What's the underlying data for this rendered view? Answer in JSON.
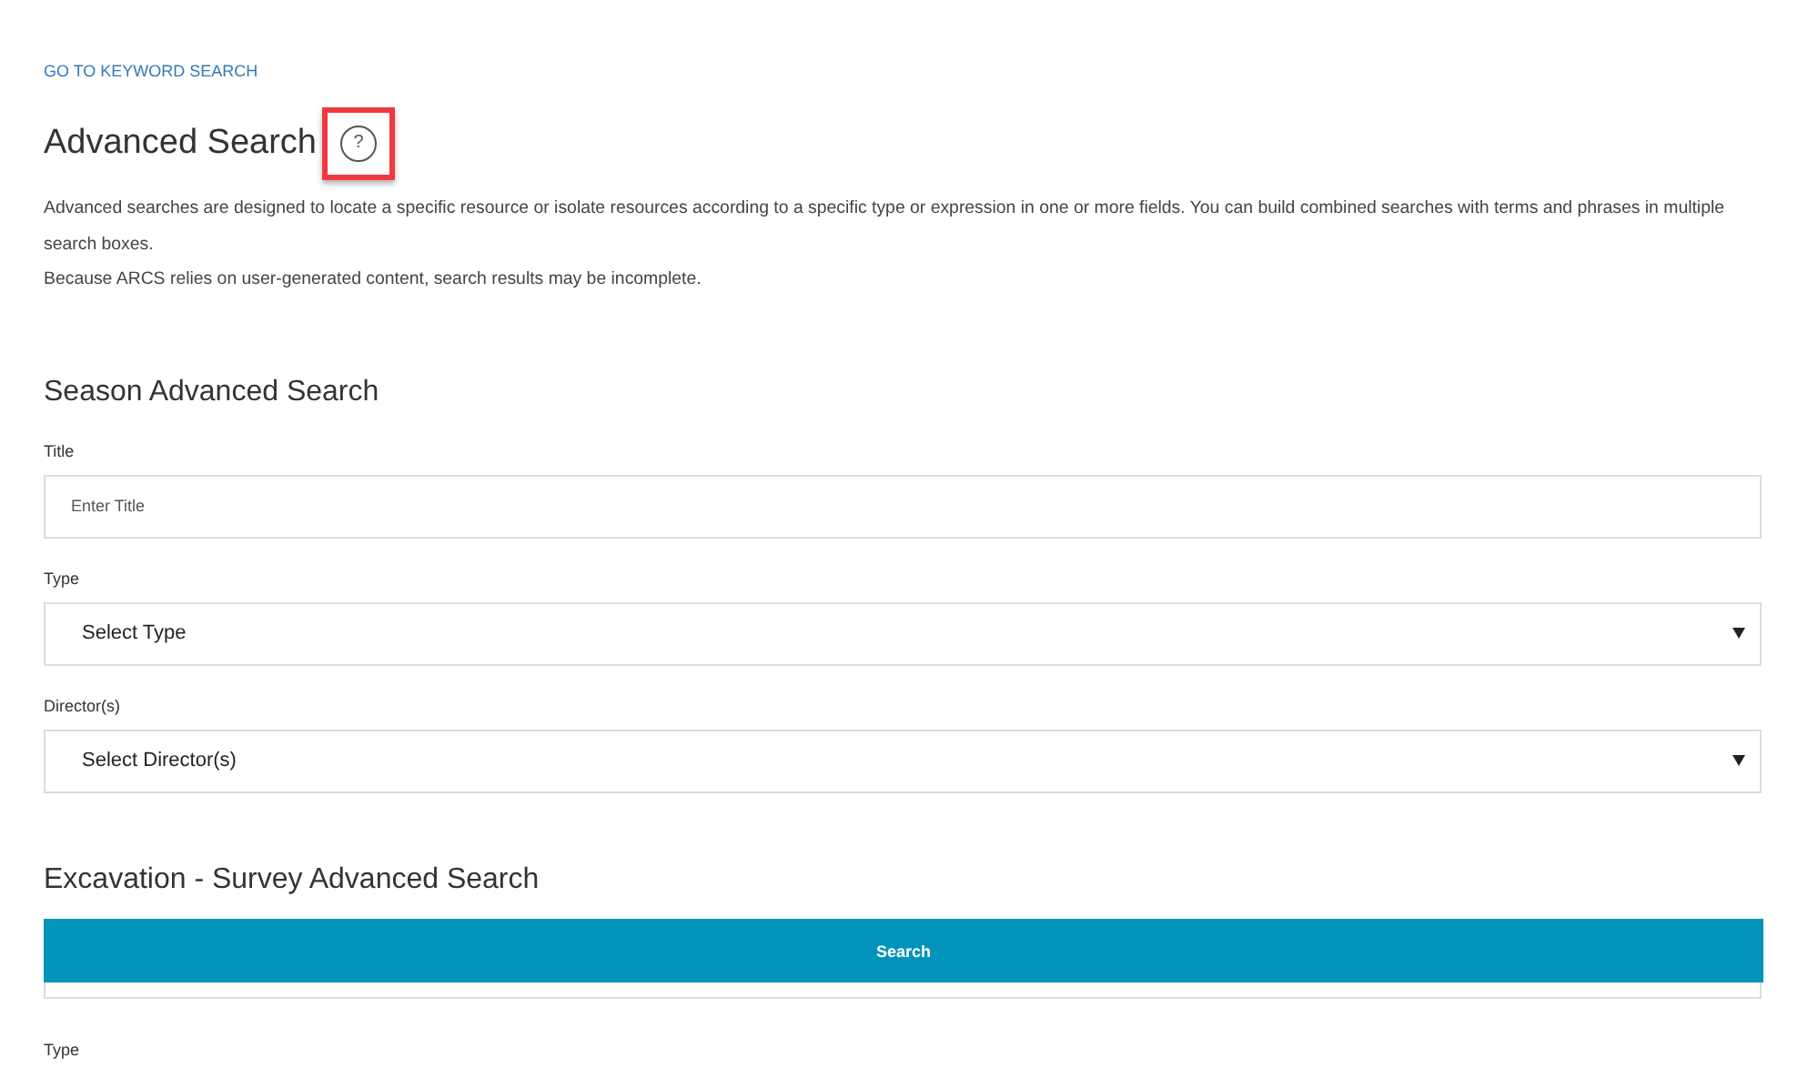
{
  "link": "GO TO KEYWORD SEARCH",
  "heading": "Advanced Search",
  "help_icon": "?",
  "help_highlighted": true,
  "description": [
    "Advanced searches are designed to locate a specific resource or isolate resources according to a specific type or expression in one or more fields. You can build combined searches with terms and phrases in multiple search boxes.",
    "Because ARCS relies on user-generated content, search results may be incomplete."
  ],
  "sections": [
    {
      "title": "Season Advanced Search",
      "fields": [
        {
          "kind": "text",
          "label": "Title",
          "placeholder": "Enter Title"
        },
        {
          "kind": "select",
          "label": "Type",
          "value": "Select Type"
        },
        {
          "kind": "select",
          "label": "Director(s)",
          "value": "Select Director(s)"
        }
      ]
    },
    {
      "title": "Excavation - Survey Advanced Search",
      "fields": [
        {
          "kind": "strip"
        },
        {
          "kind": "edge",
          "label": "Type"
        }
      ]
    }
  ],
  "search_button": "Search"
}
